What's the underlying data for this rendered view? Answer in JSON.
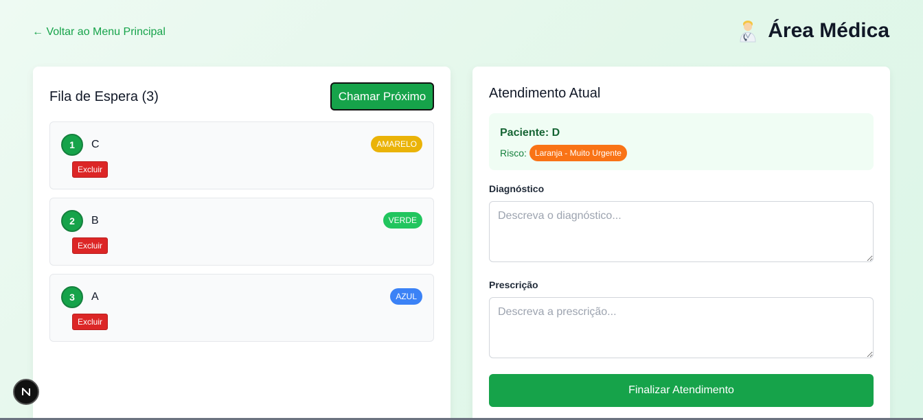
{
  "header": {
    "back_label": "← Voltar ao Menu Principal",
    "title": "Área Médica",
    "title_icon": "doctor-icon"
  },
  "queue": {
    "title": "Fila de Espera (3)",
    "call_next_label": "Chamar Próximo",
    "items": [
      {
        "number": "1",
        "name": "C",
        "badge": "AMARELO",
        "badge_color": "#eab308",
        "delete_label": "Excluir"
      },
      {
        "number": "2",
        "name": "B",
        "badge": "VERDE",
        "badge_color": "#22c55e",
        "delete_label": "Excluir"
      },
      {
        "number": "3",
        "name": "A",
        "badge": "AZUL",
        "badge_color": "#3b82f6",
        "delete_label": "Excluir"
      }
    ]
  },
  "attendance": {
    "title": "Atendimento Atual",
    "patient_label": "Paciente: D",
    "risk_label": "Risco:",
    "risk_value": "Laranja - Muito Urgente",
    "risk_color": "#f97316",
    "diagnosis_label": "Diagnóstico",
    "diagnosis_placeholder": "Descreva o diagnóstico...",
    "diagnosis_value": "",
    "prescription_label": "Prescrição",
    "prescription_placeholder": "Descreva a prescrição...",
    "prescription_value": "",
    "finish_label": "Finalizar Atendimento"
  },
  "colors": {
    "accent": "#16a34a",
    "danger": "#dc2626"
  },
  "dev_badge": {
    "icon": "nextjs-icon",
    "label": "N"
  }
}
